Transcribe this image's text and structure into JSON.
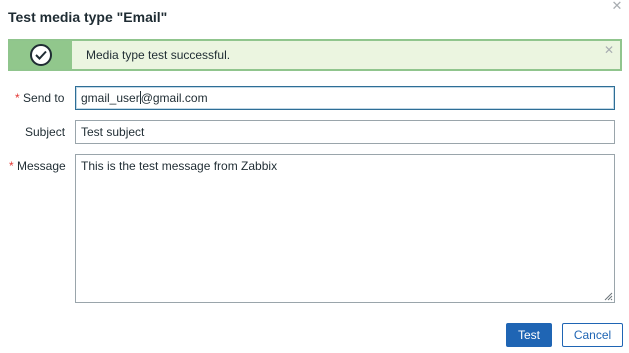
{
  "dialog": {
    "title": "Test media type \"Email\"",
    "close_icon": "close-icon"
  },
  "message": {
    "text": "Media type test successful.",
    "status": "success",
    "icon": "check-circle-icon",
    "close_icon": "close-icon"
  },
  "form": {
    "send_to": {
      "label": "Send to",
      "required": true,
      "value_before_caret": "gmail_user",
      "value_after_caret": "@gmail.com"
    },
    "subject": {
      "label": "Subject",
      "required": false,
      "value": "Test subject"
    },
    "message": {
      "label": "Message",
      "required": true,
      "value": "This is the test message from Zabbix"
    }
  },
  "buttons": {
    "test": "Test",
    "cancel": "Cancel"
  },
  "colors": {
    "success_border": "#90c58d",
    "success_bg": "#ebf5e0",
    "required_mark": "#e33734",
    "primary": "#1f65b4"
  }
}
